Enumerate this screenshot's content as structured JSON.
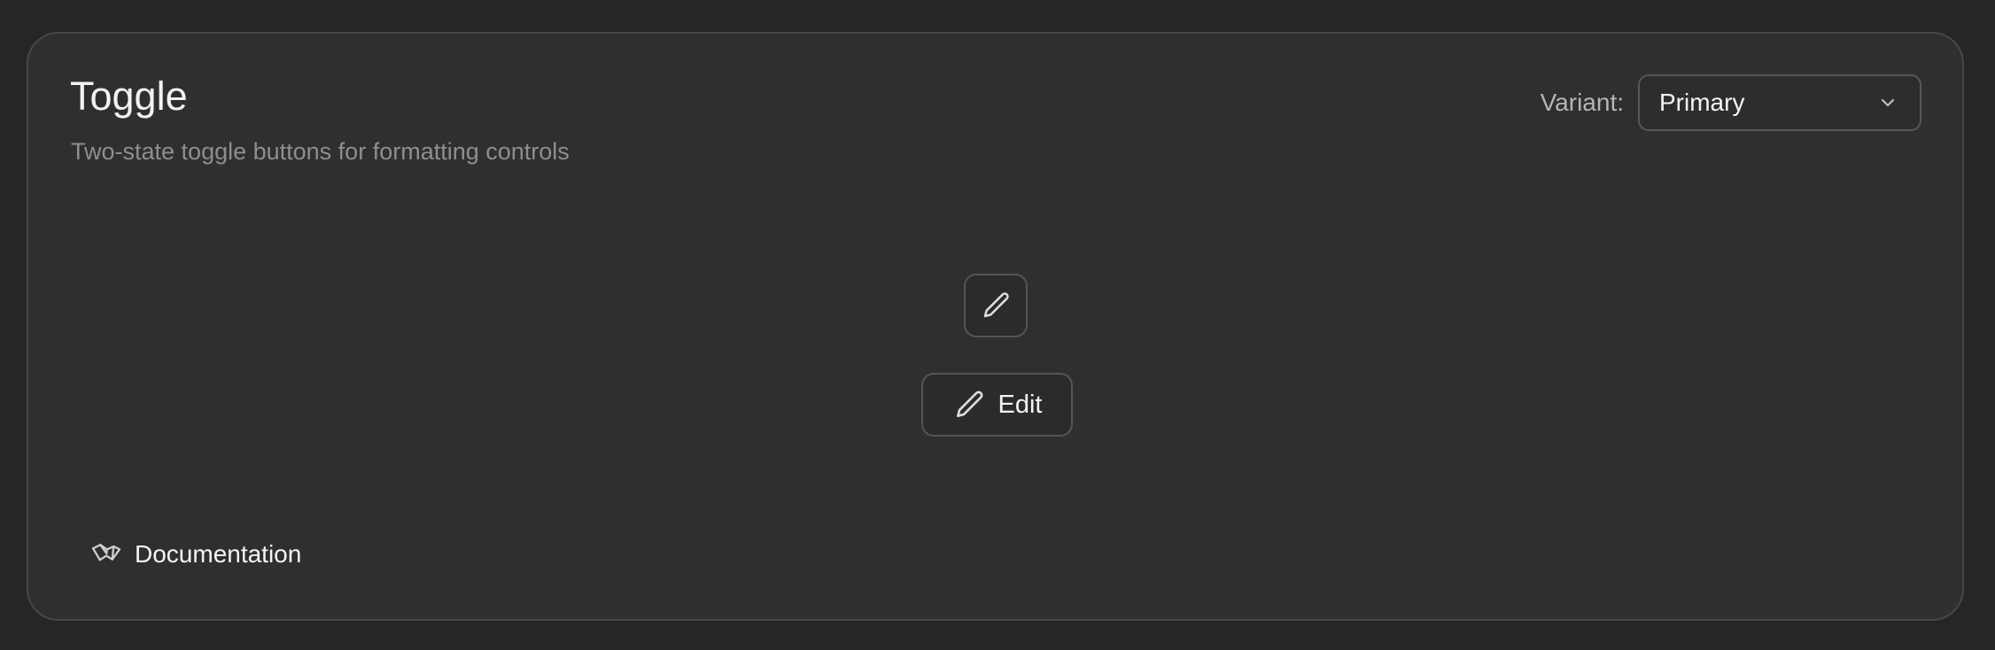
{
  "component": {
    "title": "Toggle",
    "subtitle": "Two-state toggle buttons for formatting controls"
  },
  "variant": {
    "label": "Variant:",
    "selected": "Primary"
  },
  "toggles": {
    "icon_only": {
      "icon": "pencil-icon"
    },
    "with_text": {
      "icon": "pencil-icon",
      "label": "Edit"
    }
  },
  "footer": {
    "docs_icon": "book-open-icon",
    "docs_label": "Documentation"
  },
  "colors": {
    "background": "#262626",
    "card": "#2f2f2f",
    "border": "#474747",
    "text": "#f3f3f3",
    "muted_text": "#8e8e8e"
  }
}
